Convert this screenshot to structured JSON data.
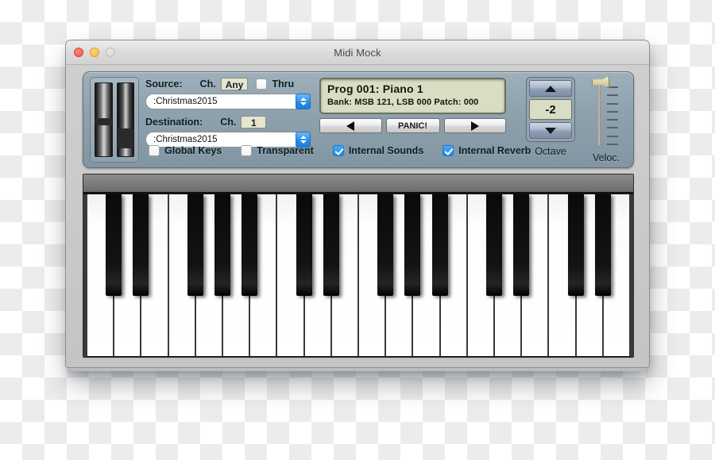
{
  "window": {
    "title": "Midi Mock",
    "traffic_lights": [
      "close",
      "minimize",
      "zoom"
    ]
  },
  "panel": {
    "source": {
      "label": "Source:",
      "channel_label": "Ch.",
      "channel_value": "Any",
      "thru_label": "Thru",
      "thru_checked": false,
      "device": ":Christmas2015"
    },
    "destination": {
      "label": "Destination:",
      "channel_label": "Ch.",
      "channel_value": "1",
      "device": ":Christmas2015"
    },
    "checkboxes": [
      {
        "label": "Global Keys",
        "checked": false
      },
      {
        "label": "Transparent",
        "checked": false
      },
      {
        "label": "Internal Sounds",
        "checked": true
      },
      {
        "label": "Internal Reverb",
        "checked": true
      }
    ],
    "lcd": {
      "line1": "Prog 001: Piano 1",
      "line2": "Bank: MSB 121, LSB 000  Patch: 000"
    },
    "program_buttons": {
      "prev": "◀",
      "panic": "PANIC!",
      "next": "▶"
    },
    "octave": {
      "value": "-2",
      "caption": "Octave",
      "up": "▲",
      "down": "▼"
    },
    "velocity": {
      "caption": "Veloc.",
      "position_percent": 100
    }
  },
  "keyboard": {
    "white_key_count": 20,
    "black_key_pattern": [
      1,
      1,
      0,
      1,
      1,
      1,
      0
    ],
    "colors": {
      "white": "#ffffff",
      "black": "#0a0a0a"
    }
  },
  "colors": {
    "panel": "#8fa2ae",
    "lcd": "#d8dec3",
    "accent_blue": "#1f8ae8",
    "titlebar": "#dcdcdc"
  }
}
